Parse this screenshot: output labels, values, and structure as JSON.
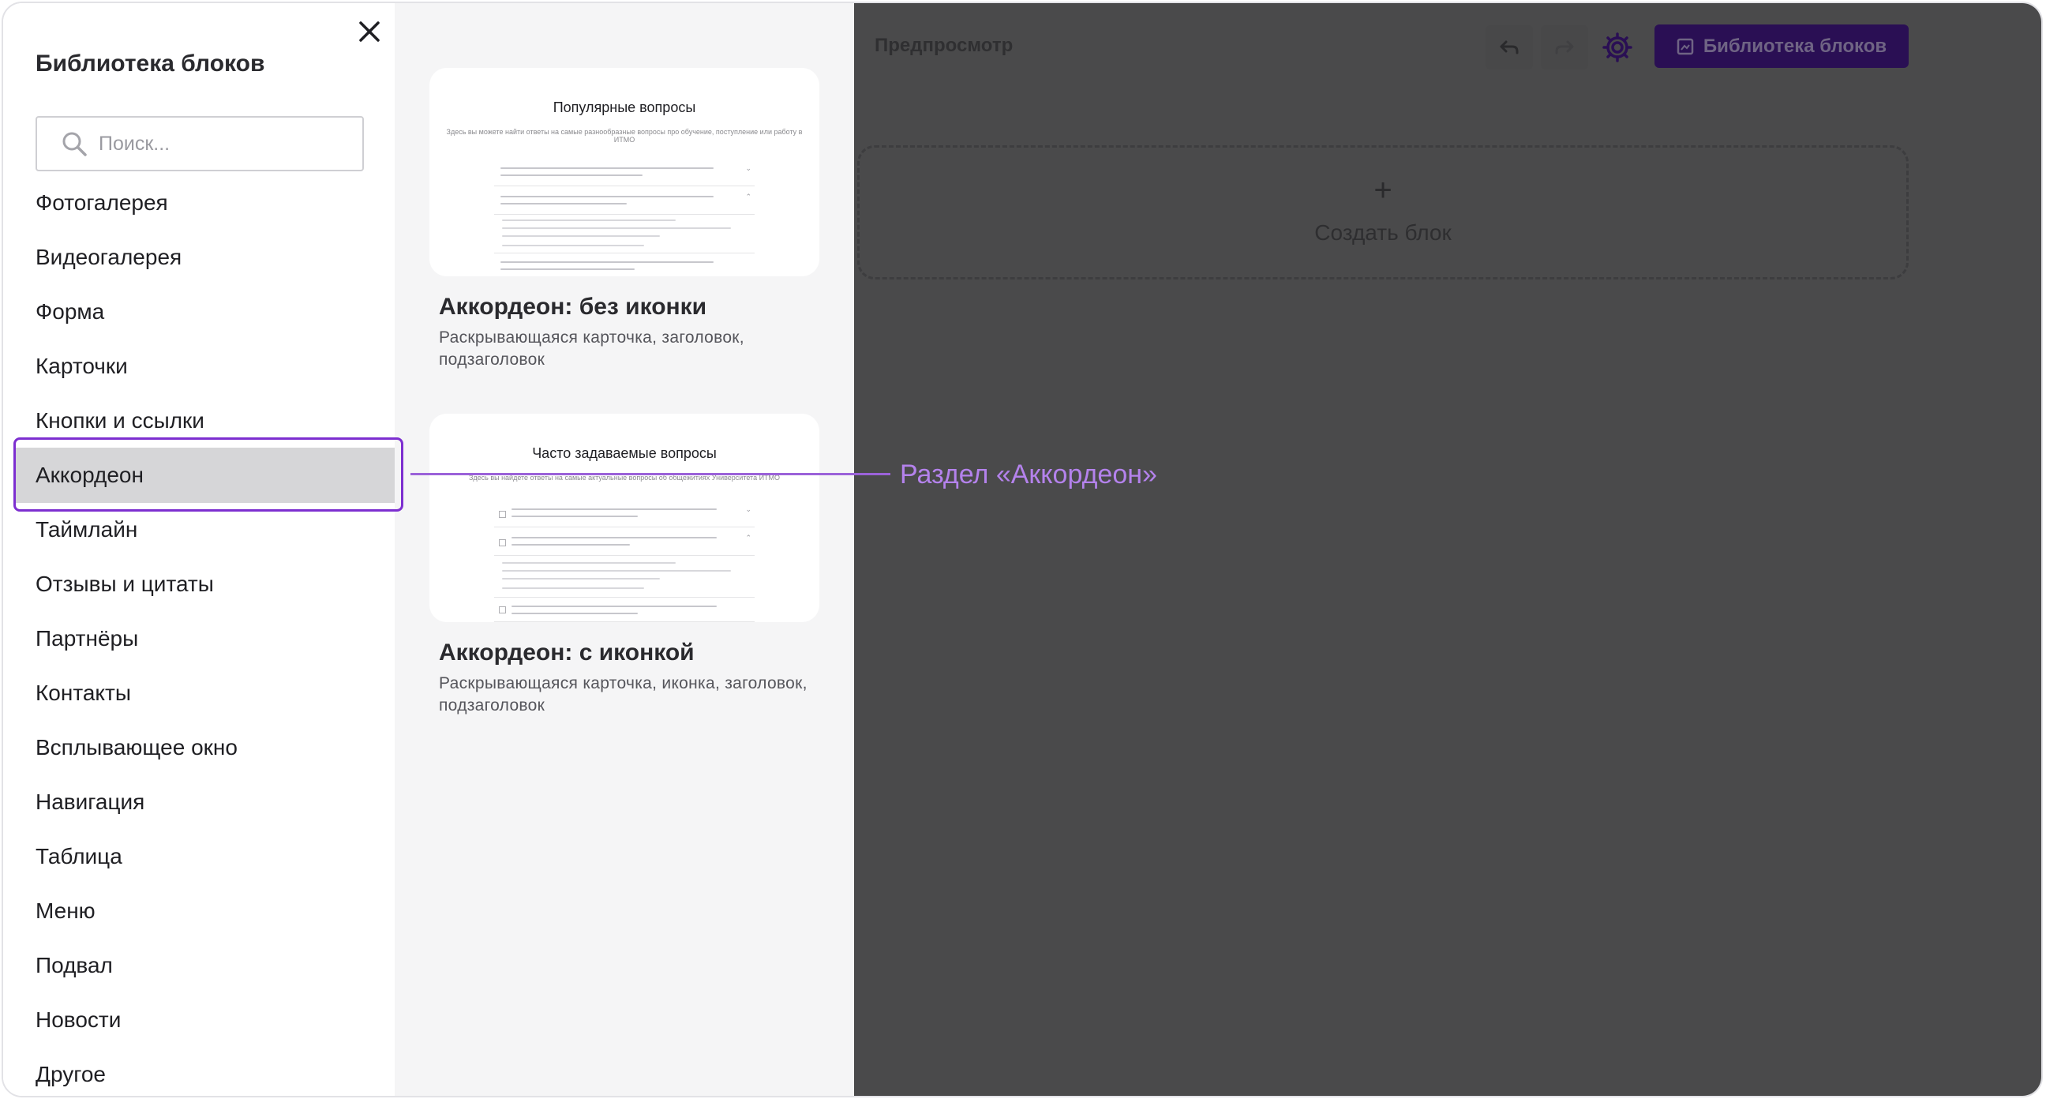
{
  "sidebar": {
    "title": "Библиотека блоков",
    "search_placeholder": "Поиск...",
    "categories": [
      "Фотогалерея",
      "Видеогалерея",
      "Форма",
      "Карточки",
      "Кнопки и ссылки",
      "Аккордеон",
      "Таймлайн",
      "Отзывы и цитаты",
      "Партнёры",
      "Контакты",
      "Всплывающее окно",
      "Навигация",
      "Таблица",
      "Меню",
      "Подвал",
      "Новости",
      "Другое"
    ],
    "active_category": "Аккордеон"
  },
  "blocks": [
    {
      "thumb_heading": "Популярные вопросы",
      "thumb_sub": "Здесь вы можете найти ответы на самые разнообразные вопросы про обучение, поступление или работу в ИТМО",
      "title": "Аккордеон: без иконки",
      "description": "Раскрывающаяся карточка, заголовок, подзаголовок"
    },
    {
      "thumb_heading": "Часто задаваемые вопросы",
      "thumb_sub": "Здесь вы найдете ответы на самые актуальные вопросы об общежитиях Университета ИТМО",
      "title": "Аккордеон: с иконкой",
      "description": "Раскрывающаяся карточка, иконка, заголовок, подзаголовок"
    }
  ],
  "editor": {
    "title": "Предпросмотр",
    "library_button": "Библиотека блоков",
    "create_block": "Создать блок",
    "plus": "+"
  },
  "annotation": {
    "label": "Раздел «Аккордеон»"
  },
  "colors": {
    "accent": "#7d2fd0",
    "callout": "#b482ec",
    "overlay": "#4a4a4b",
    "active_bg": "#d6d6d8"
  }
}
